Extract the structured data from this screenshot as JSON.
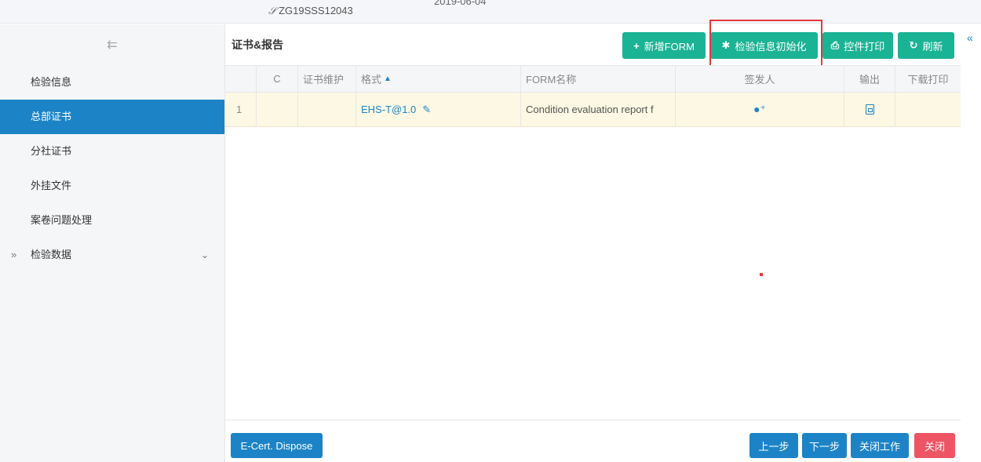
{
  "top": {
    "ref_number": "ZG19SSS12043",
    "date": "2019-06-04"
  },
  "sidebar": {
    "items": [
      {
        "label": "检验信息",
        "active": false
      },
      {
        "label": "总部证书",
        "active": true
      },
      {
        "label": "分社证书",
        "active": false
      },
      {
        "label": "外挂文件",
        "active": false
      },
      {
        "label": "案卷问题处理",
        "active": false
      },
      {
        "label": "检验数据",
        "active": false,
        "expandable": true
      }
    ]
  },
  "panel": {
    "title": "证书&报告"
  },
  "toolbar": {
    "new_form": "新增FORM",
    "init_info": "检验信息初始化",
    "print_control": "控件打印",
    "refresh": "刷新"
  },
  "table": {
    "headers": [
      "C",
      "证书维护",
      "格式",
      "FORM名称",
      "签发人",
      "输出",
      "下载打印"
    ],
    "rows": [
      {
        "index": "1",
        "c": "",
        "maintain": "",
        "format": "EHS-T@1.0",
        "form_name": "Condition evaluation report f",
        "signer_icon": "add-user-icon",
        "output_icon": "pdf-icon",
        "download": ""
      }
    ]
  },
  "footer": {
    "ecert": "E-Cert. Dispose",
    "prev": "上一步",
    "next": "下一步",
    "close_work": "关闭工作",
    "close": "关闭"
  },
  "colors": {
    "primary_blue": "#1c84c6",
    "green": "#1ab394",
    "red": "#ed5565",
    "selected_row": "#fcf8e3",
    "highlight_border": "#e53935"
  }
}
